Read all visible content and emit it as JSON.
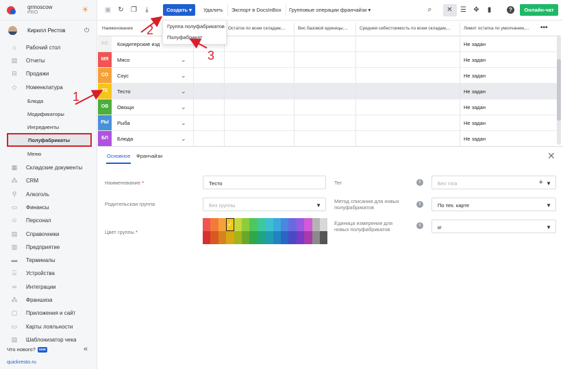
{
  "brand": {
    "name": "qrmoscow",
    "plan": "PRO"
  },
  "user": {
    "name": "Кирилл Рестов"
  },
  "sidebar": {
    "items": [
      {
        "label": "Рабочий стол",
        "icon": "home-icon"
      },
      {
        "label": "Отчеты",
        "icon": "reports-icon"
      },
      {
        "label": "Продажи",
        "icon": "sales-icon"
      },
      {
        "label": "Номенклатура",
        "icon": "nomenclature-icon"
      }
    ],
    "sub_items": [
      "Блюда",
      "Модификаторы",
      "Ингредиенты",
      "Полуфабрикаты",
      "Меню"
    ],
    "items2": [
      {
        "label": "Складские документы",
        "icon": "warehouse-icon"
      },
      {
        "label": "CRM",
        "icon": "crm-icon"
      },
      {
        "label": "Алкоголь",
        "icon": "alcohol-icon"
      },
      {
        "label": "Финансы",
        "icon": "finance-icon"
      },
      {
        "label": "Персонал",
        "icon": "staff-icon"
      },
      {
        "label": "Справочники",
        "icon": "reference-icon"
      },
      {
        "label": "Предприятие",
        "icon": "enterprise-icon"
      },
      {
        "label": "Терминалы",
        "icon": "terminal-icon"
      },
      {
        "label": "Устройства",
        "icon": "devices-icon"
      },
      {
        "label": "Интеграции",
        "icon": "integrations-icon"
      },
      {
        "label": "Франшиза",
        "icon": "franchise-icon"
      },
      {
        "label": "Приложения и сайт",
        "icon": "apps-icon"
      },
      {
        "label": "Карты лояльности",
        "icon": "loyalty-icon"
      },
      {
        "label": "Шаблонизатор чека",
        "icon": "receipt-icon"
      }
    ],
    "whats_new": "Что нового?",
    "new_badge": "new",
    "site": "quickresto.ru"
  },
  "toolbar": {
    "create": "Создать",
    "delete": "Удалить",
    "export": "Экспорт в DocsInBox",
    "group_ops": "Групповые операции франчайзи",
    "chat": "Онлайн-чат"
  },
  "dropdown": {
    "items": [
      "Группа полуфабрикатов",
      "Полуфабрикат"
    ]
  },
  "annotations": [
    "1",
    "2",
    "3"
  ],
  "table": {
    "columns": [
      "Наименование",
      "Остаток по всем складам,...",
      "Вес базовой единицы,...",
      "Средняя себестоимость по всем складам,...",
      "Лимит остатка по умолчанию,..."
    ],
    "rows": [
      {
        "tag": "КО",
        "name": "Кондитерские изд",
        "color": "#f2f2f2",
        "tagtext": "#ccc",
        "limit": "Не задан"
      },
      {
        "tag": "МЯ",
        "name": "Мясо",
        "color": "#f05454",
        "tagtext": "#fff",
        "limit": "Не задан"
      },
      {
        "tag": "СО",
        "name": "Соус",
        "color": "#f5a03a",
        "tagtext": "#fff",
        "limit": "Не задан"
      },
      {
        "tag": "ТЕ",
        "name": "Тесто",
        "color": "#f5c518",
        "tagtext": "#fff",
        "limit": "Не задан"
      },
      {
        "tag": "ОВ",
        "name": "Овощи",
        "color": "#4cae3c",
        "tagtext": "#fff",
        "limit": "Не задан"
      },
      {
        "tag": "РЫ",
        "name": "Рыба",
        "color": "#4a90d9",
        "tagtext": "#fff",
        "limit": "Не задан"
      },
      {
        "tag": "БЛ",
        "name": "Блюда",
        "color": "#b052e0",
        "tagtext": "#fff",
        "limit": "Не задан"
      }
    ]
  },
  "panel": {
    "tabs": [
      "Основное",
      "Франчайзи"
    ],
    "name_label": "Наименование",
    "name_value": "Тесто",
    "parent_label": "Родительская группа",
    "parent_placeholder": "Без группы",
    "color_label": "Цвет группы",
    "tag_label": "Тег",
    "tag_placeholder": "Без тэга",
    "method_label": "Метод списания для новых полуфабрикатов",
    "method_value": "По тех. карте",
    "unit_label": "Единица измерения для новых полуфабрикатов",
    "unit_value": "кг",
    "required_mark": "*",
    "palette_top": [
      "#f05454",
      "#f57a3a",
      "#f5a03a",
      "#f5c518",
      "#c8d63a",
      "#8fcc3c",
      "#4cc860",
      "#3cc8a0",
      "#3cc0d0",
      "#3ca8e0",
      "#4a88e0",
      "#6a6ae0",
      "#9a5ae0",
      "#d25ad6",
      "#b4b4b4",
      "#d8d8d8"
    ],
    "palette_bottom": [
      "#d83030",
      "#d85a20",
      "#d8821e",
      "#d8a814",
      "#a4b41c",
      "#6aa82a",
      "#2ea84a",
      "#20a484",
      "#209cb0",
      "#2084c0",
      "#2a66c4",
      "#4a4ac4",
      "#7a3ac4",
      "#a83aac",
      "#8a8a8a",
      "#555555"
    ],
    "selected_swatch": "✓"
  }
}
